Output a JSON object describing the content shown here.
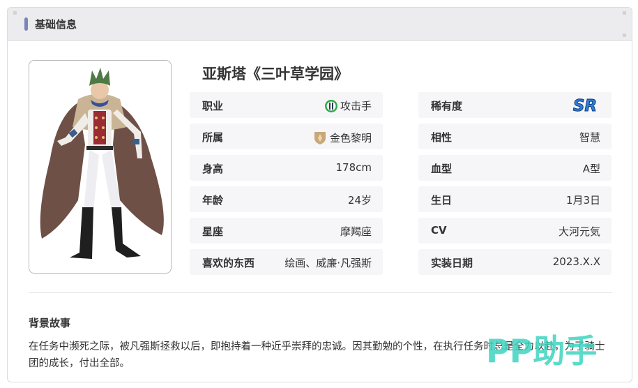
{
  "header": {
    "title": "基础信息"
  },
  "character": {
    "name": "亚斯塔《三叶草学园》"
  },
  "info": {
    "profession": {
      "label": "职业",
      "value": "攻击手"
    },
    "faction": {
      "label": "所属",
      "value": "金色黎明"
    },
    "height": {
      "label": "身高",
      "value": "178cm"
    },
    "age": {
      "label": "年龄",
      "value": "24岁"
    },
    "constellation": {
      "label": "星座",
      "value": "摩羯座"
    },
    "likes": {
      "label": "喜欢的东西",
      "value": "绘画、威廉·凡强斯"
    },
    "rarity": {
      "label": "稀有度",
      "value": "SR"
    },
    "affinity": {
      "label": "相性",
      "value": "智慧"
    },
    "blood_type": {
      "label": "血型",
      "value": "A型"
    },
    "birthday": {
      "label": "生日",
      "value": "1月3日"
    },
    "cv": {
      "label": "CV",
      "value": "大河元気"
    },
    "release_date": {
      "label": "实装日期",
      "value": "2023.X.X"
    }
  },
  "story": {
    "title": "背景故事",
    "text": "在任务中濒死之际，被凡强斯拯救以后，即抱持着一种近乎崇拜的忠诚。因其勤勉的个性，在执行任务时总是全力以赴，为了骑士团的成长，付出全部。"
  },
  "watermark": {
    "text": "PP助手"
  },
  "colors": {
    "accent_bar": "#7b86b8",
    "rarity_blue": "#2f7fd6",
    "profession_green": "#2eaa4a",
    "faction_gold": "#c9a878",
    "watermark_teal": "#3fd3bf"
  },
  "icons": {
    "profession": "attacker-icon",
    "faction": "golden-dawn-emblem-icon",
    "rarity": "sr-badge-icon"
  }
}
